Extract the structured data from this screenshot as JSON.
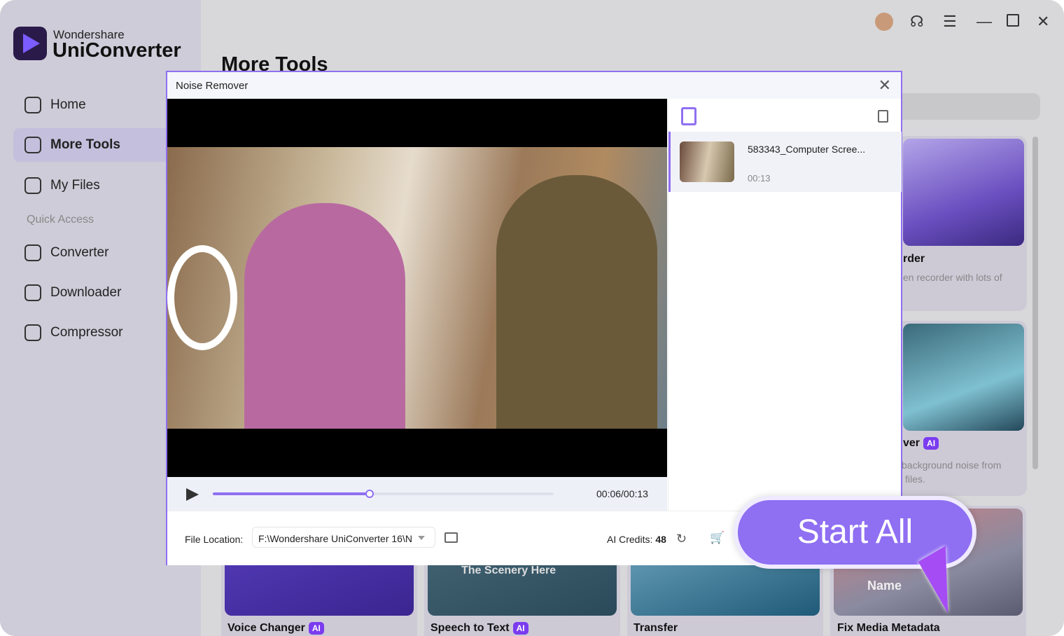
{
  "app": {
    "brand_top": "Wondershare",
    "brand_name": "UniConverter",
    "page_title": "More Tools"
  },
  "sidebar": {
    "items": [
      {
        "label": "Home"
      },
      {
        "label": "More Tools",
        "active": true
      },
      {
        "label": "My Files"
      }
    ],
    "quick_access_label": "Quick Access",
    "quick": [
      {
        "label": "Converter"
      },
      {
        "label": "Downloader"
      },
      {
        "label": "Compressor"
      }
    ]
  },
  "topbar": {
    "icons": [
      "avatar",
      "headset-icon",
      "menu-icon",
      "minimize-icon",
      "maximize-icon",
      "close-icon"
    ]
  },
  "cards": {
    "recorder": {
      "title": "rder",
      "desc": "en recorder with lots of"
    },
    "noise": {
      "title": "ver",
      "badge": "AI",
      "desc1": "background noise from",
      "desc2": "files."
    },
    "bottom": [
      {
        "title": "Voice Changer",
        "badge": "AI"
      },
      {
        "title": "Speech to Text",
        "badge": "AI",
        "overlay": "The Scenery Here"
      },
      {
        "title": "Transfer"
      },
      {
        "title": "Fix Media Metadata",
        "overlay": "Name"
      }
    ]
  },
  "dialog": {
    "title": "Noise Remover",
    "file": {
      "name": "583343_Computer Scree...",
      "duration": "00:13"
    },
    "player": {
      "time": "00:06/00:13",
      "progress": 0.46
    },
    "file_location_label": "File Location:",
    "file_location_value": "F:\\Wondershare UniConverter 16\\N",
    "ai_credits_label": "AI Credits:",
    "ai_credits_value": "48",
    "start_all": "Start All"
  },
  "colors": {
    "accent": "#8f6ff2"
  }
}
